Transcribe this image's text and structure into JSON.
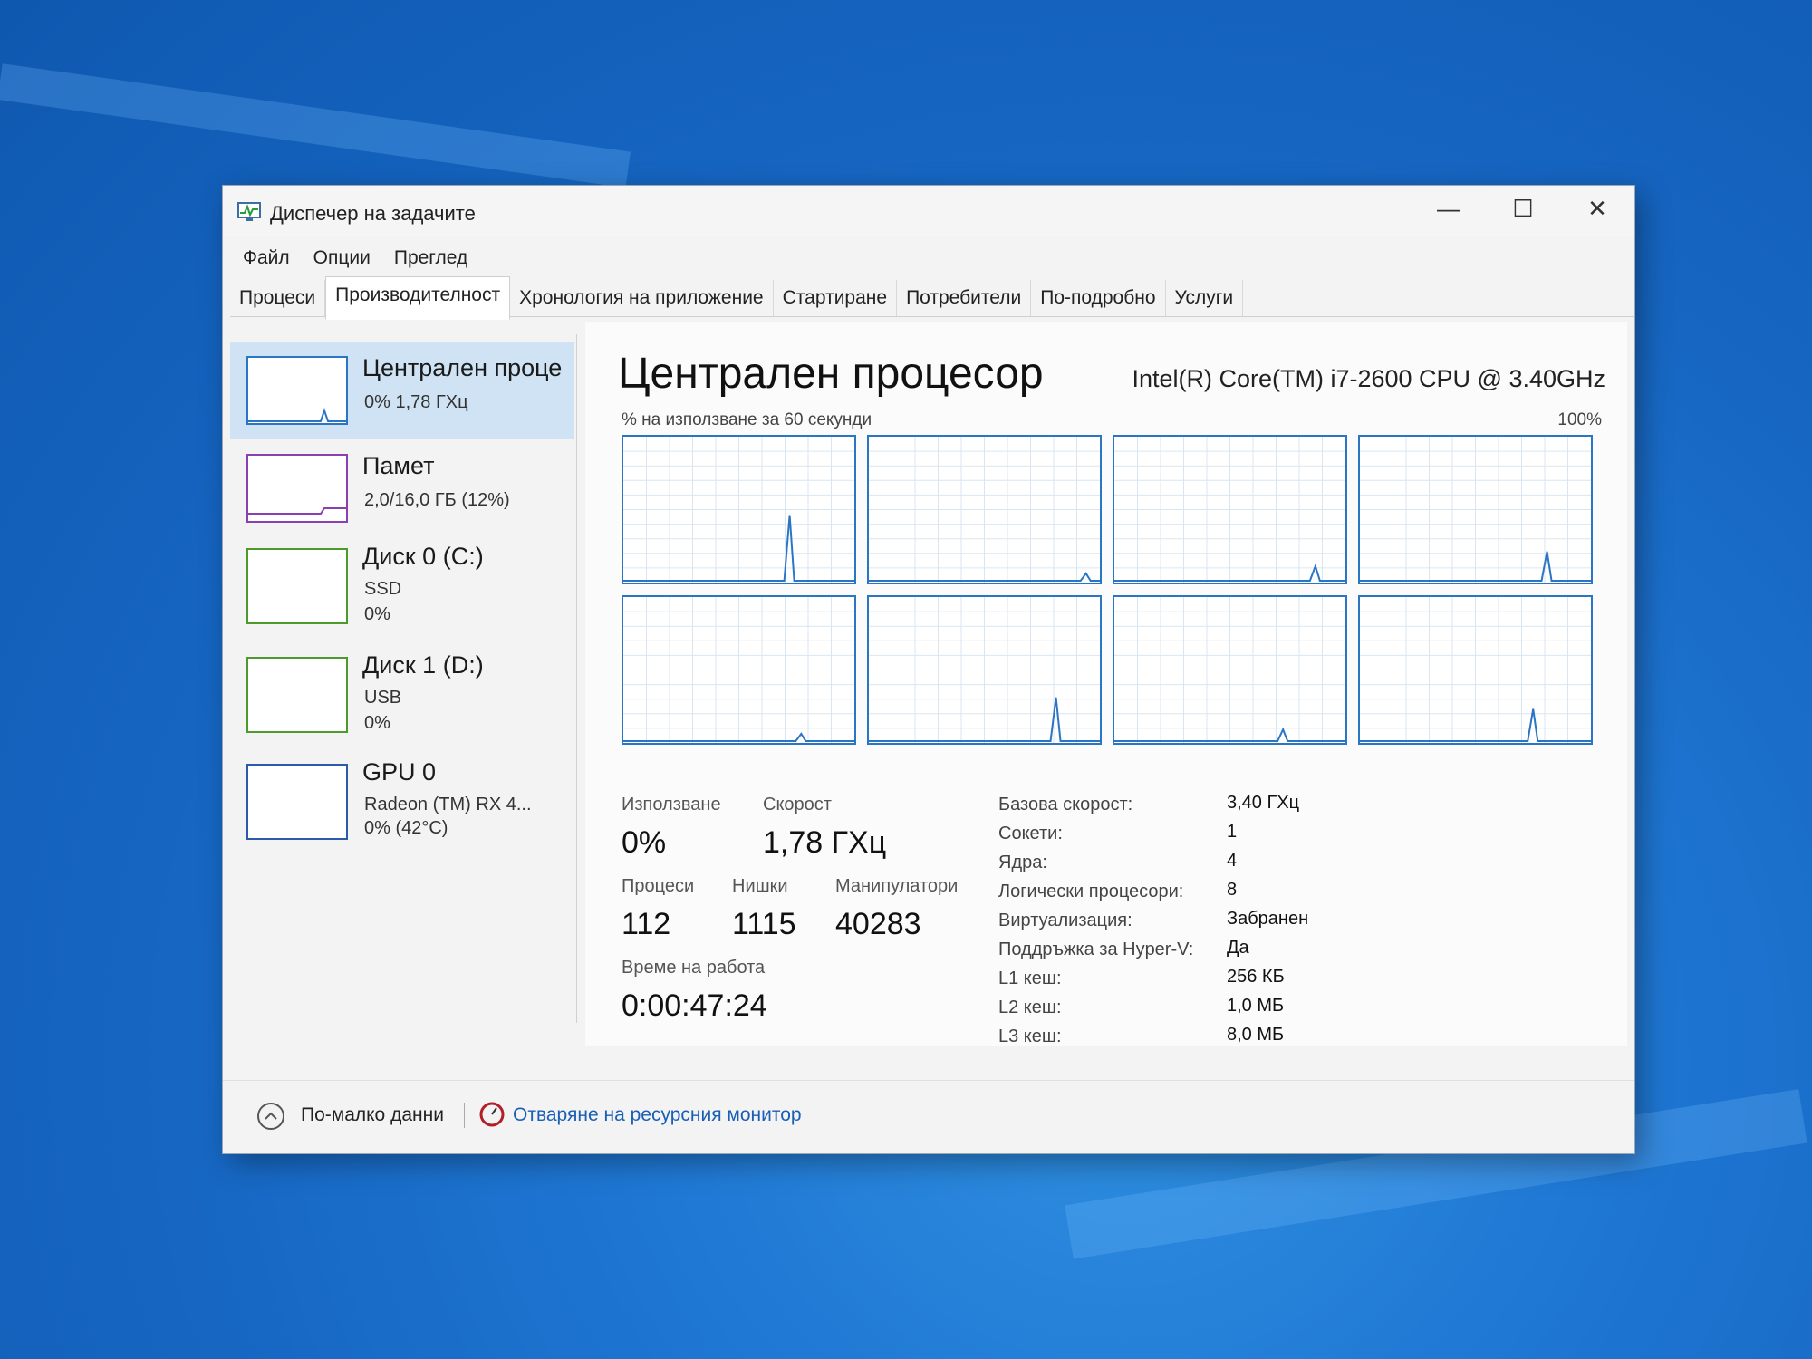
{
  "window": {
    "title": "Диспечер на задачите"
  },
  "menu": [
    "Файл",
    "Опции",
    "Преглед"
  ],
  "tabs": [
    "Процеси",
    "Производителност",
    "Хронология на приложение",
    "Стартиране",
    "Потребители",
    "По-подробно",
    "Услуги"
  ],
  "active_tab": "Производителност",
  "sidebar": {
    "items": [
      {
        "title": "Централен проце",
        "lines": [
          "0% 1,78 ГХц"
        ]
      },
      {
        "title": "Памет",
        "lines": [
          "2,0/16,0 ГБ (12%)"
        ]
      },
      {
        "title": "Диск 0 (C:)",
        "lines": [
          "SSD",
          "0%"
        ]
      },
      {
        "title": "Диск 1 (D:)",
        "lines": [
          "USB",
          "0%"
        ]
      },
      {
        "title": "GPU 0",
        "lines": [
          "Radeon (TM) RX 4...",
          "0% (42°C)"
        ]
      }
    ]
  },
  "main": {
    "title": "Централен процесор",
    "cpu_name": "Intel(R) Core(TM) i7-2600 CPU @ 3.40GHz",
    "graph_label": "% на използване за 60 секунди",
    "graph_max": "100%",
    "core_graphs_count": 8,
    "stats": {
      "usage_label": "Използване",
      "usage_value": "0%",
      "speed_label": "Скорост",
      "speed_value": "1,78 ГХц",
      "processes_label": "Процеси",
      "processes_value": "112",
      "threads_label": "Нишки",
      "threads_value": "1115",
      "handles_label": "Манипулатори",
      "handles_value": "40283",
      "uptime_label": "Време на работа",
      "uptime_value": "0:00:47:24"
    },
    "specs": [
      {
        "label": "Базова скорост:",
        "value": "3,40 ГХц"
      },
      {
        "label": "Сокети:",
        "value": "1"
      },
      {
        "label": "Ядра:",
        "value": "4"
      },
      {
        "label": "Логически процесори:",
        "value": "8"
      },
      {
        "label": "Виртуализация:",
        "value": "Забранен"
      },
      {
        "label": "Поддръжка за Hyper-V:",
        "value": "Да"
      },
      {
        "label": "L1 кеш:",
        "value": "256 КБ"
      },
      {
        "label": "L2 кеш:",
        "value": "1,0 МБ"
      },
      {
        "label": "L3 кеш:",
        "value": "8,0 МБ"
      }
    ]
  },
  "footer": {
    "less_details": "По-малко данни",
    "resource_monitor": "Отваряне на ресурсния монитор"
  },
  "colors": {
    "accent": "#2a75c4",
    "grid": "#d9e6f2",
    "cpu_line": "#2a75c4",
    "memory_line": "#8b3fb0",
    "disk_line": "#4c9a2a",
    "gpu_line": "#2a5aa8"
  }
}
